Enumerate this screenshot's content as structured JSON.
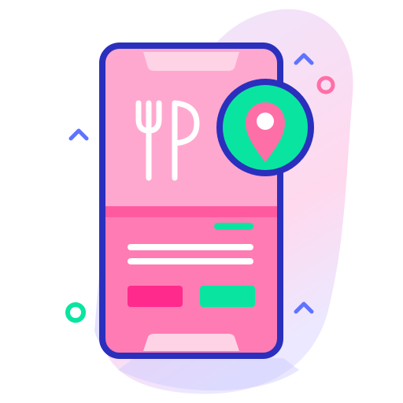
{
  "illustration": {
    "subject": "restaurant-locator-phone-icon",
    "icons": [
      "fork-icon",
      "knife-icon",
      "location-pin-icon",
      "chevron-up-icon",
      "ring-icon"
    ]
  },
  "colors": {
    "outline": "#2b2fbd",
    "phone_fill": "#fd6ea8",
    "screen_top": "#ffa8cf",
    "screen_divider": "#ff5aa0",
    "screen_bottom": "#ff7bb3",
    "notch": "#ffd3e6",
    "accent_green": "#09e5a0",
    "accent_magenta": "#ff2a8c",
    "white": "#ffffff",
    "blob_light": "#ece8ff",
    "blob_pink": "#ffd9ee",
    "blob_purple": "#cdc9ff",
    "chevron": "#5f73ff",
    "ring_pink": "#ff6fa7",
    "ring_green": "#09e5a0"
  }
}
